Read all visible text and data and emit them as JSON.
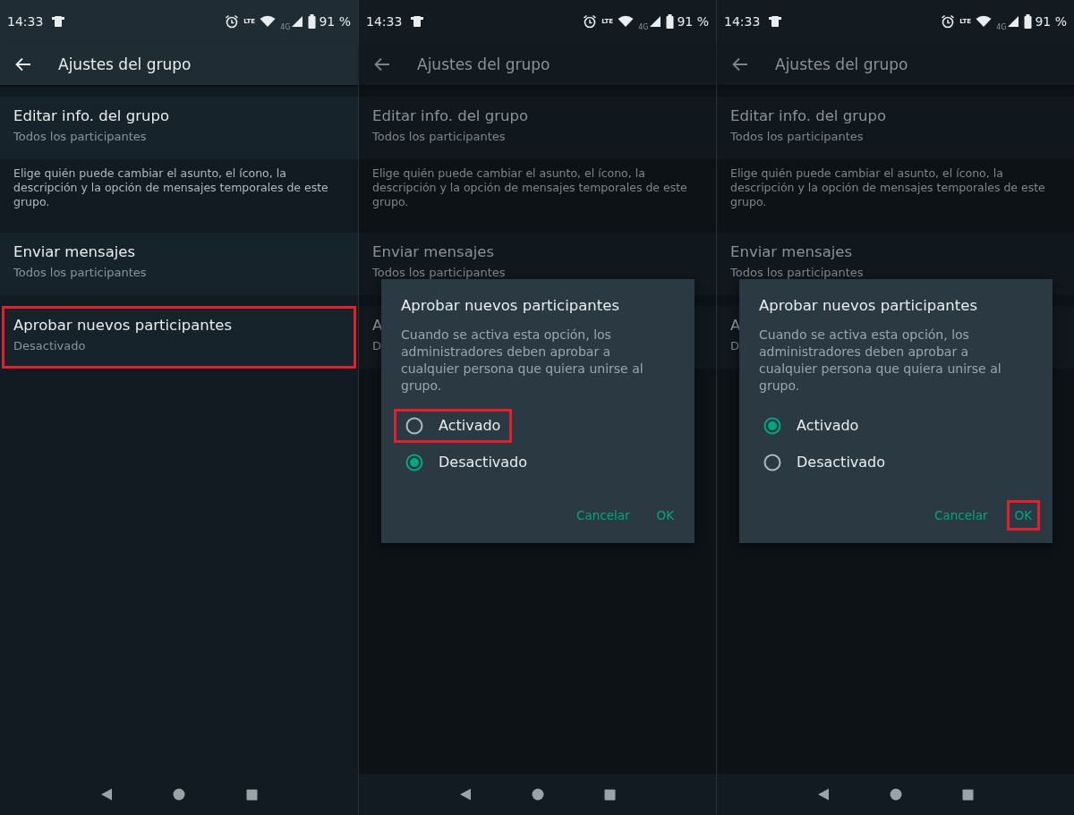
{
  "panels": [
    {
      "status_bar": {
        "time": "14:33",
        "network": "4G",
        "lte": "LTE",
        "battery": "91 %"
      },
      "app_bar": {
        "title": "Ajustes del grupo"
      },
      "dimmed": false,
      "items": [
        {
          "kind": "setting",
          "title": "Editar info. del grupo",
          "subtitle": "Todos los participantes",
          "highlighted": false
        },
        {
          "kind": "note",
          "text": "Elige quién puede cambiar el asunto, el ícono, la descripción y la opción de mensajes temporales de este grupo."
        },
        {
          "kind": "setting",
          "title": "Enviar mensajes",
          "subtitle": "Todos los participantes",
          "highlighted": false
        },
        {
          "kind": "setting",
          "title": "Aprobar nuevos participantes",
          "subtitle": "Desactivado",
          "highlighted": true
        }
      ]
    },
    {
      "status_bar": {
        "time": "14:33",
        "network": "4G",
        "lte": "LTE",
        "battery": "91 %"
      },
      "app_bar": {
        "title": "Ajustes del grupo"
      },
      "dimmed": true,
      "items": [
        {
          "kind": "setting",
          "title": "Editar info. del grupo",
          "subtitle": "Todos los participantes",
          "highlighted": false
        },
        {
          "kind": "note",
          "text": "Elige quién puede cambiar el asunto, el ícono, la descripción y la opción de mensajes temporales de este grupo."
        },
        {
          "kind": "setting",
          "title": "Enviar mensajes",
          "subtitle": "Todos los participantes",
          "highlighted": false
        },
        {
          "kind": "setting",
          "title": "A",
          "subtitle": "D",
          "highlighted": false
        }
      ],
      "dialog": {
        "title": "Aprobar nuevos participantes",
        "message": "Cuando se activa esta opción, los administradores deben aprobar a cualquier persona que quiera unirse al grupo.",
        "options": [
          {
            "label": "Activado",
            "selected": false,
            "highlighted": true
          },
          {
            "label": "Desactivado",
            "selected": true,
            "highlighted": false
          }
        ],
        "buttons": [
          {
            "label": "Cancelar",
            "highlighted": false
          },
          {
            "label": "OK",
            "highlighted": false
          }
        ]
      }
    },
    {
      "status_bar": {
        "time": "14:33",
        "network": "4G",
        "lte": "LTE",
        "battery": "91 %"
      },
      "app_bar": {
        "title": "Ajustes del grupo"
      },
      "dimmed": true,
      "items": [
        {
          "kind": "setting",
          "title": "Editar info. del grupo",
          "subtitle": "Todos los participantes",
          "highlighted": false
        },
        {
          "kind": "note",
          "text": "Elige quién puede cambiar el asunto, el ícono, la descripción y la opción de mensajes temporales de este grupo."
        },
        {
          "kind": "setting",
          "title": "Enviar mensajes",
          "subtitle": "Todos los participantes",
          "highlighted": false
        },
        {
          "kind": "setting",
          "title": "A",
          "subtitle": "D",
          "highlighted": false
        }
      ],
      "dialog": {
        "title": "Aprobar nuevos participantes",
        "message": "Cuando se activa esta opción, los administradores deben aprobar a cualquier persona que quiera unirse al grupo.",
        "options": [
          {
            "label": "Activado",
            "selected": true,
            "highlighted": false
          },
          {
            "label": "Desactivado",
            "selected": false,
            "highlighted": false
          }
        ],
        "buttons": [
          {
            "label": "Cancelar",
            "highlighted": false
          },
          {
            "label": "OK",
            "highlighted": true
          }
        ]
      }
    }
  ]
}
